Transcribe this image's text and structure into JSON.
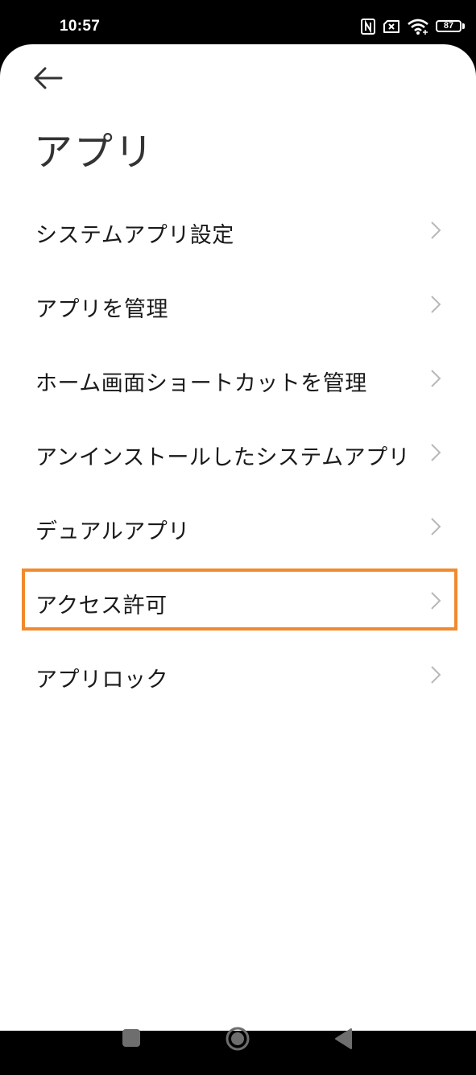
{
  "status_bar": {
    "time": "10:57",
    "battery": "87",
    "icons": [
      "nfc-icon",
      "no-sim-icon",
      "wifi-icon",
      "battery-icon"
    ]
  },
  "header": {
    "back_icon": "arrow-left-icon",
    "title": "アプリ"
  },
  "menu": {
    "items": [
      {
        "label": "システムアプリ設定"
      },
      {
        "label": "アプリを管理"
      },
      {
        "label": "ホーム画面ショートカットを管理"
      },
      {
        "label": "アンインストールしたシステムアプリ"
      },
      {
        "label": "デュアルアプリ"
      },
      {
        "label": "アクセス許可",
        "highlighted": true
      },
      {
        "label": "アプリロック"
      }
    ],
    "chevron_icon": "chevron-right-icon"
  },
  "navigation": {
    "buttons": [
      "recents-button",
      "home-button",
      "back-button"
    ]
  },
  "colors": {
    "highlight": "#f18a2c",
    "text": "#1a1a1a",
    "title": "#333333",
    "chevron": "#b8b8b8",
    "nav_icons": "#6e6e6e"
  }
}
